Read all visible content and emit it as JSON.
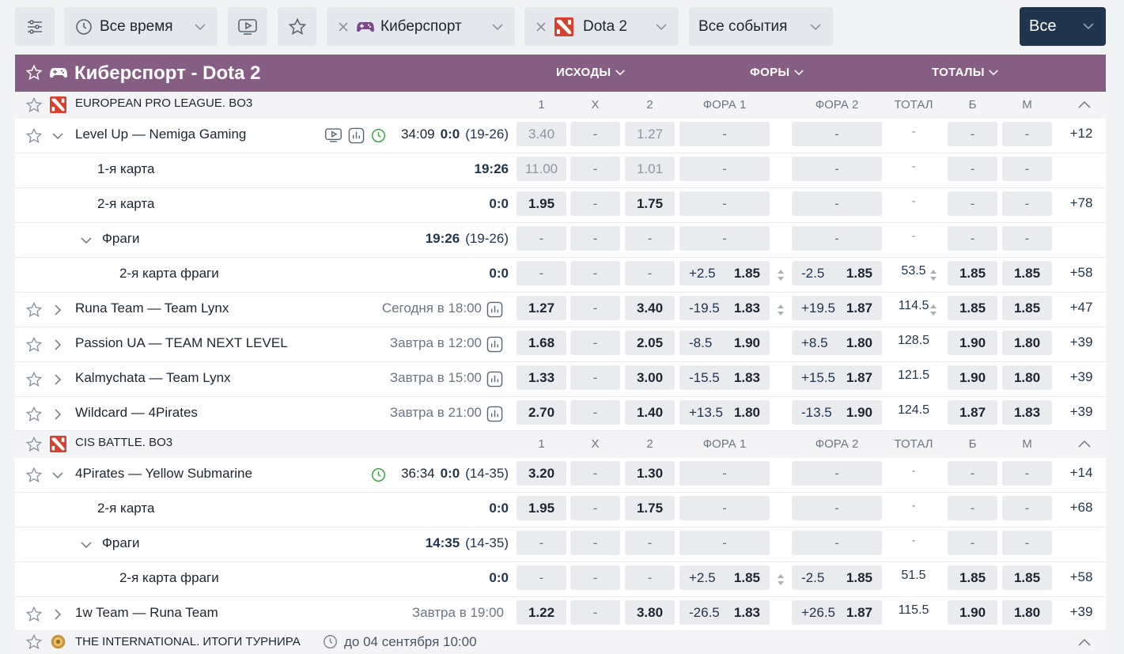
{
  "filters": {
    "settings_icon": "sliders-icon",
    "time_label": "Все время",
    "video_icon": "tv-icon",
    "favorites_icon": "star-icon",
    "sport_label": "Киберспорт",
    "game_label": "Dota 2",
    "events_label": "Все события",
    "all_label": "Все"
  },
  "colors": {
    "accent": "#875e83",
    "navy": "#22354e",
    "live": "#2e9b39"
  },
  "header": {
    "title": "Киберспорт - Dota 2",
    "col_outcomes": "ИСХОДЫ",
    "col_handicaps": "ФОРЫ",
    "col_totals": "ТОТАЛЫ"
  },
  "col_headers": {
    "c1": "1",
    "cx": "X",
    "c2": "2",
    "f1": "ФОРА 1",
    "f2": "ФОРА 2",
    "tot": "ТОТАЛ",
    "b": "Б",
    "m": "М"
  },
  "leagues": [
    {
      "name": "EUROPEAN PRO LEAGUE. BO3"
    },
    {
      "name": "CIS BATTLE. BO3"
    },
    {
      "name": "THE INTERNATIONAL. ИТОГИ ТУРНИРА",
      "date": "до 04 сентября 10:00"
    }
  ],
  "rows": [
    {
      "name": "Level Up — Nemiga Gaming",
      "clock": "34:09",
      "score": "0:0",
      "period": "(19-26)",
      "v1": "3.40",
      "vx": "-",
      "v2": "1.27",
      "f1": "-",
      "f2": "-",
      "tot": "-",
      "b": "-",
      "m": "-",
      "more": "+12"
    },
    {
      "name": "1-я карта",
      "score": "19:26",
      "v1": "11.00",
      "vx": "-",
      "v2": "1.01",
      "f1": "-",
      "f2": "-",
      "tot": "-",
      "b": "-",
      "m": "-"
    },
    {
      "name": "2-я карта",
      "score": "0:0",
      "v1": "1.95",
      "vx": "-",
      "v2": "1.75",
      "f1": "-",
      "f2": "-",
      "tot": "-",
      "b": "-",
      "m": "-",
      "more": "+78"
    },
    {
      "name": "Фраги",
      "score": "19:26",
      "period": "(19-26)",
      "v1": "-",
      "vx": "-",
      "v2": "-",
      "f1": "-",
      "f2": "-",
      "tot": "-",
      "b": "-",
      "m": "-"
    },
    {
      "name": "2-я карта фраги",
      "score": "0:0",
      "v1": "-",
      "vx": "-",
      "v2": "-",
      "f1h": "+2.5",
      "f1o": "1.85",
      "f2h": "-2.5",
      "f2o": "1.85",
      "tot": "53.5",
      "b": "1.85",
      "m": "1.85",
      "more": "+58"
    },
    {
      "name": "Runa Team — Team Lynx",
      "time": "Сегодня в 18:00",
      "v1": "1.27",
      "vx": "-",
      "v2": "3.40",
      "f1h": "-19.5",
      "f1o": "1.83",
      "f2h": "+19.5",
      "f2o": "1.87",
      "tot": "114.5",
      "b": "1.85",
      "m": "1.85",
      "more": "+47"
    },
    {
      "name": "Passion UA — TEAM NEXT LEVEL",
      "time": "Завтра в 12:00",
      "v1": "1.68",
      "vx": "-",
      "v2": "2.05",
      "f1h": "-8.5",
      "f1o": "1.90",
      "f2h": "+8.5",
      "f2o": "1.80",
      "tot": "128.5",
      "b": "1.90",
      "m": "1.80",
      "more": "+39"
    },
    {
      "name": "Kalmychata — Team Lynx",
      "time": "Завтра в 15:00",
      "v1": "1.33",
      "vx": "-",
      "v2": "3.00",
      "f1h": "-15.5",
      "f1o": "1.83",
      "f2h": "+15.5",
      "f2o": "1.87",
      "tot": "121.5",
      "b": "1.90",
      "m": "1.80",
      "more": "+39"
    },
    {
      "name": "Wildcard — 4Pirates",
      "time": "Завтра в 21:00",
      "v1": "2.70",
      "vx": "-",
      "v2": "1.40",
      "f1h": "+13.5",
      "f1o": "1.80",
      "f2h": "-13.5",
      "f2o": "1.90",
      "tot": "124.5",
      "b": "1.87",
      "m": "1.83",
      "more": "+39"
    },
    {
      "name": "4Pirates — Yellow Submarine",
      "clock": "36:34",
      "score": "0:0",
      "period": "(14-35)",
      "v1": "3.20",
      "vx": "-",
      "v2": "1.30",
      "f1": "-",
      "f2": "-",
      "tot": "-",
      "b": "-",
      "m": "-",
      "more": "+14"
    },
    {
      "name": "2-я карта",
      "score": "0:0",
      "v1": "1.95",
      "vx": "-",
      "v2": "1.75",
      "f1": "-",
      "f2": "-",
      "tot": "-",
      "b": "-",
      "m": "-",
      "more": "+68"
    },
    {
      "name": "Фраги",
      "score": "14:35",
      "period": "(14-35)",
      "v1": "-",
      "vx": "-",
      "v2": "-",
      "f1": "-",
      "f2": "-",
      "tot": "-",
      "b": "-",
      "m": "-"
    },
    {
      "name": "2-я карта фраги",
      "score": "0:0",
      "v1": "-",
      "vx": "-",
      "v2": "-",
      "f1h": "+2.5",
      "f1o": "1.85",
      "f2h": "-2.5",
      "f2o": "1.85",
      "tot": "51.5",
      "b": "1.85",
      "m": "1.85",
      "more": "+58"
    },
    {
      "name": "1w Team — Runa Team",
      "time": "Завтра в 19:00",
      "v1": "1.22",
      "vx": "-",
      "v2": "3.80",
      "f1h": "-26.5",
      "f1o": "1.83",
      "f2h": "+26.5",
      "f2o": "1.87",
      "tot": "115.5",
      "b": "1.90",
      "m": "1.80",
      "more": "+39"
    }
  ]
}
